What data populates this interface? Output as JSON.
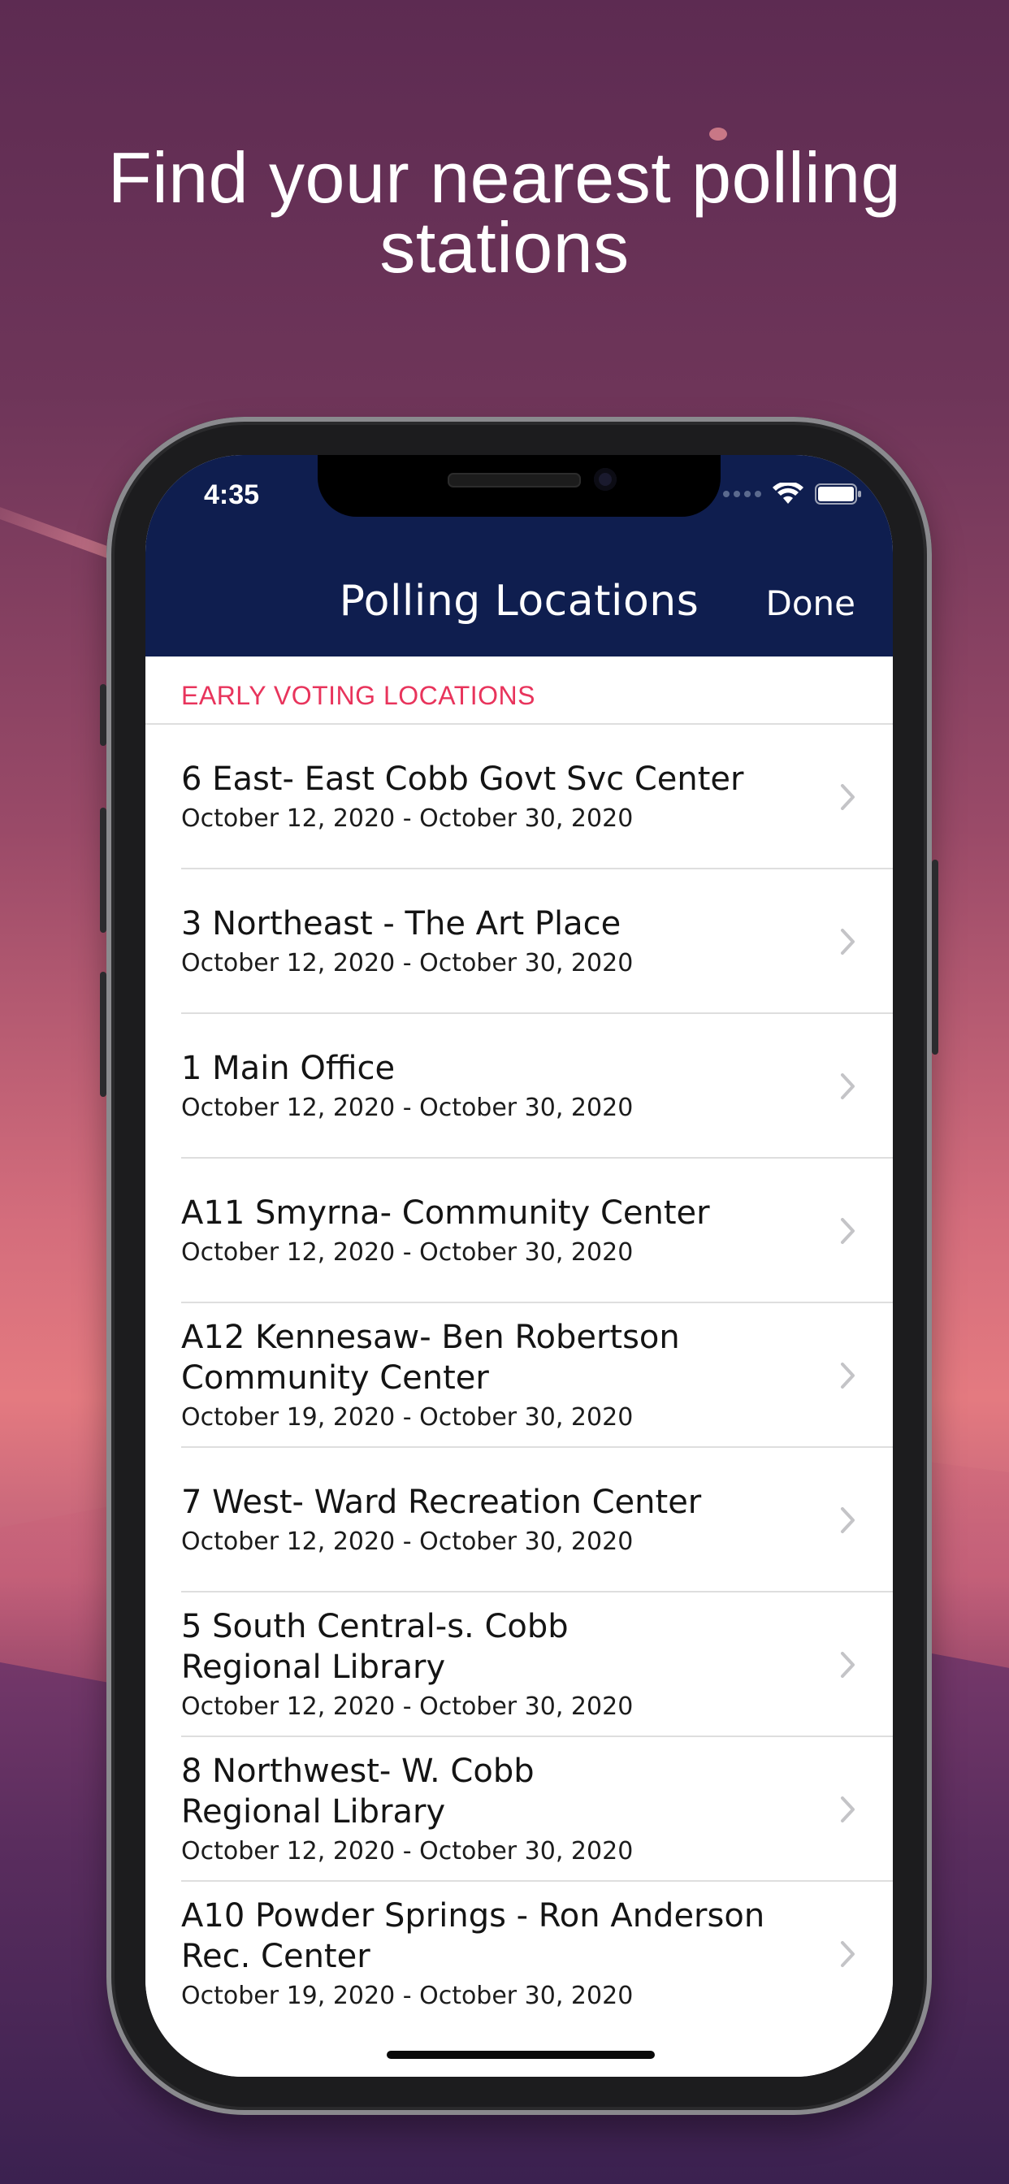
{
  "promo": {
    "headline": "Find your nearest polling stations"
  },
  "status_bar": {
    "time": "4:35",
    "icons": [
      "signal-icon",
      "wifi-icon",
      "battery-icon"
    ]
  },
  "nav": {
    "title": "Polling Locations",
    "done_label": "Done"
  },
  "section": {
    "header": "EARLY VOTING LOCATIONS"
  },
  "locations": [
    {
      "name": "6 East- East Cobb Govt Svc Center",
      "dates": "October 12, 2020 - October 30, 2020"
    },
    {
      "name": "3 Northeast - The Art Place",
      "dates": "October 12, 2020 - October 30, 2020"
    },
    {
      "name": "1 Main Office",
      "dates": "October 12, 2020 - October 30, 2020"
    },
    {
      "name": "A11 Smyrna- Community Center",
      "dates": "October 12, 2020 - October 30, 2020"
    },
    {
      "name": "A12 Kennesaw- Ben Robertson\nCommunity Center",
      "dates": "October 19, 2020 - October 30, 2020"
    },
    {
      "name": "7 West- Ward Recreation Center",
      "dates": "October 12, 2020 - October 30, 2020"
    },
    {
      "name": "5 South Central-s. Cobb\nRegional Library",
      "dates": "October 12, 2020 - October 30, 2020"
    },
    {
      "name": "8 Northwest- W. Cobb\nRegional Library",
      "dates": "October 12, 2020 - October 30, 2020"
    },
    {
      "name": "A10 Powder Springs - Ron Anderson\nRec. Center",
      "dates": "October 19, 2020 - October 30, 2020"
    }
  ],
  "colors": {
    "nav_background": "#0f1e4f",
    "section_header": "#e8345c",
    "separator": "#dedede"
  }
}
